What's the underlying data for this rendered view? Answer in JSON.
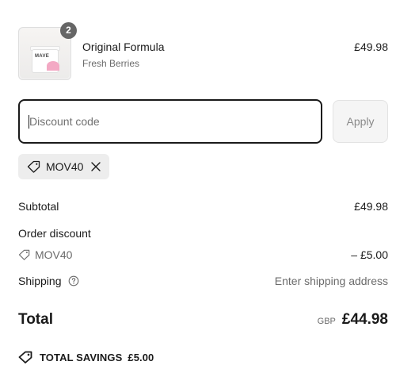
{
  "product": {
    "quantity_badge": "2",
    "jar_label": "MAVE",
    "name": "Original Formula",
    "variant": "Fresh Berries",
    "price": "£49.98",
    "icon": "product-thumbnail"
  },
  "discount": {
    "placeholder": "Discount code",
    "value": "",
    "apply_label": "Apply",
    "applied_code": "MOV40",
    "tag_icon": "tag-icon",
    "remove_icon": "close-icon"
  },
  "summary": {
    "subtotal_label": "Subtotal",
    "subtotal_value": "£49.98",
    "order_discount_label": "Order discount",
    "discount_code": "MOV40",
    "discount_value": "– £5.00",
    "shipping_label": "Shipping",
    "shipping_help_icon": "help-circle-icon",
    "shipping_value": "Enter shipping address",
    "total_label": "Total",
    "currency": "GBP",
    "total_value": "£44.98",
    "savings_label": "TOTAL SAVINGS",
    "savings_value": "£5.00"
  },
  "colors": {
    "text": "#1a1a1a",
    "muted": "#6b6b6b",
    "badge": "#666666",
    "chip_bg": "#ededed",
    "input_border": "#1a1a1a"
  }
}
